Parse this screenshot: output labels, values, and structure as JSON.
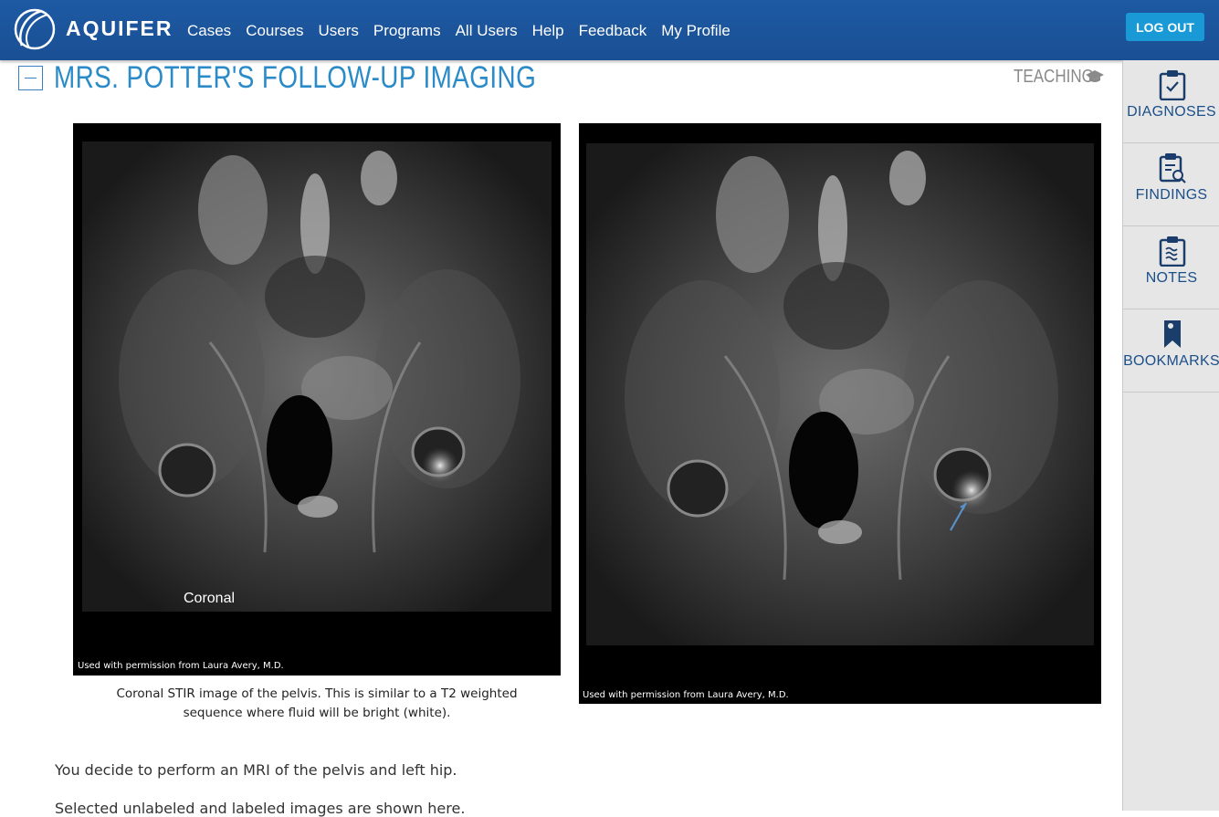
{
  "app": {
    "brand": "AQUIFER",
    "nav": [
      "Cases",
      "Courses",
      "Users",
      "Programs",
      "All Users",
      "Help",
      "Feedback",
      "My Profile"
    ],
    "logout_label": "LOG OUT"
  },
  "sidebar": {
    "items": [
      {
        "label": "DIAGNOSES",
        "icon": "clipboard-check-icon"
      },
      {
        "label": "FINDINGS",
        "icon": "clipboard-search-icon"
      },
      {
        "label": "NOTES",
        "icon": "clipboard-notes-icon"
      },
      {
        "label": "BOOKMARKS",
        "icon": "bookmark-icon"
      }
    ]
  },
  "section": {
    "title": "MRS. POTTER'S FOLLOW-UP IMAGING",
    "badge": "TEACHING"
  },
  "images": {
    "left": {
      "overlay_label": "Coronal",
      "credit": "Used with permission from Laura Avery, M.D.",
      "caption": "Coronal STIR image of the pelvis. This is similar to a T2 weighted sequence where fluid will be bright (white)."
    },
    "right": {
      "credit": "Used with permission from Laura Avery, M.D."
    }
  },
  "body": {
    "para1": "You decide to perform an MRI of the pelvis and left hip.",
    "para2": "Selected unlabeled and labeled images are shown here."
  },
  "colors": {
    "navbar": "#1a4f94",
    "logout": "#199ad6",
    "title": "#2a8bc8",
    "sidebar_text": "#1b4f8a"
  }
}
